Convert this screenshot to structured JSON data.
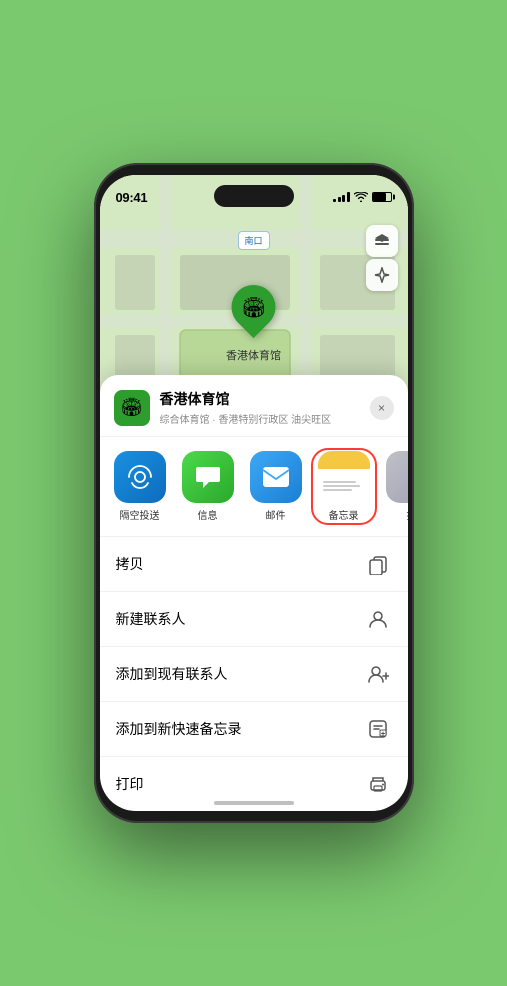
{
  "status_bar": {
    "time": "09:41",
    "signal_label": "signal",
    "wifi_label": "wifi",
    "battery_label": "battery"
  },
  "map": {
    "label": "南口",
    "map_icon_label": "map-layers",
    "location_icon_label": "location-arrow"
  },
  "venue": {
    "name": "香港体育馆",
    "subtitle": "综合体育馆 · 香港特别行政区 油尖旺区",
    "pin_emoji": "🏟",
    "pin_label": "香港体育馆"
  },
  "share_items": [
    {
      "id": "airdrop",
      "label": "隔空投送",
      "emoji": "📡",
      "type": "airdrop"
    },
    {
      "id": "messages",
      "label": "信息",
      "emoji": "💬",
      "type": "messages"
    },
    {
      "id": "mail",
      "label": "邮件",
      "emoji": "✉️",
      "type": "mail"
    },
    {
      "id": "notes",
      "label": "备忘录",
      "emoji": "📝",
      "type": "notes",
      "selected": true
    },
    {
      "id": "more",
      "label": "推",
      "type": "more"
    }
  ],
  "actions": [
    {
      "id": "copy",
      "label": "拷贝",
      "icon": "copy"
    },
    {
      "id": "new-contact",
      "label": "新建联系人",
      "icon": "person"
    },
    {
      "id": "add-existing",
      "label": "添加到现有联系人",
      "icon": "person-add"
    },
    {
      "id": "add-notes",
      "label": "添加到新快速备忘录",
      "icon": "notes-add"
    },
    {
      "id": "print",
      "label": "打印",
      "icon": "print"
    }
  ],
  "close_label": "×"
}
